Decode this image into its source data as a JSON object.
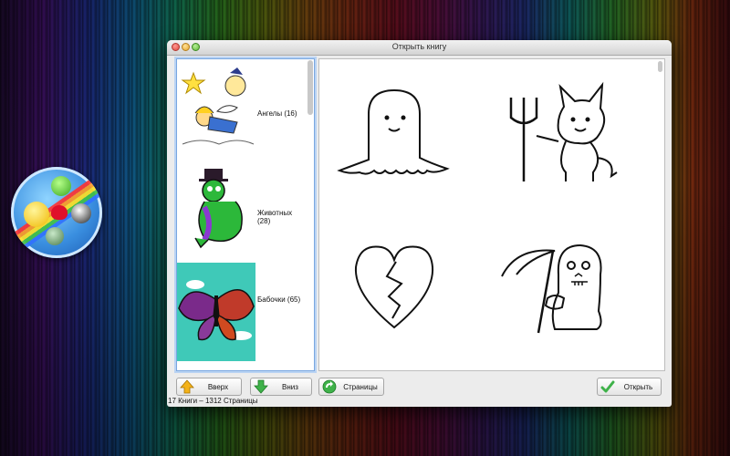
{
  "window": {
    "title": "Открыть книгу"
  },
  "books": [
    {
      "label": "Ангелы (16)",
      "thumb": "angel-picture"
    },
    {
      "label": "Животных (28)",
      "thumb": "dinosaur-picture"
    },
    {
      "label": "Бабочки (65)",
      "thumb": "butterfly-picture"
    }
  ],
  "preview": {
    "pages": [
      "ghost-drawing",
      "devil-drawing",
      "broken-heart-drawing",
      "grim-reaper-drawing"
    ]
  },
  "buttons": {
    "up": "Вверх",
    "down": "Вниз",
    "pages": "Страницы",
    "open": "Открыть"
  },
  "status": "17 Книги – 1312 Страницы",
  "colors": {
    "list_border": "#7aa7e0",
    "up_arrow": "#f3b21a",
    "down_arrow": "#3fb24a",
    "check": "#3fb24a"
  }
}
